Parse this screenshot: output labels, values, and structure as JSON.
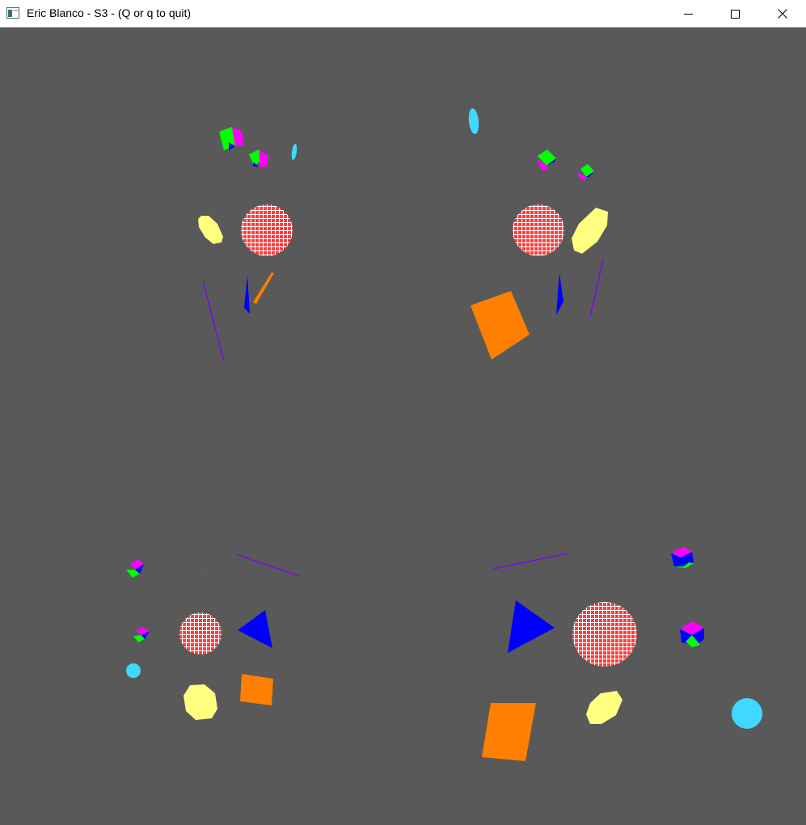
{
  "window": {
    "title": "Eric Blanco - S3 - (Q or q to quit)",
    "controls": [
      "minimize",
      "maximize",
      "close"
    ],
    "icons": {
      "app": "window-app-icon",
      "minimize": "minimize-icon",
      "maximize": "maximize-icon",
      "close": "close-icon"
    }
  },
  "scene": {
    "background_color": "#595959",
    "viewports": [
      "top-left",
      "top-right",
      "bottom-left",
      "bottom-right"
    ],
    "colors": {
      "sphere": "#ff3b3b",
      "sphere_grid": "#ffffff",
      "ellipse": "#ffff80",
      "quad": "#ff7f00",
      "triangle": "#0000ff",
      "line": "#7f00ff",
      "cube_faces": [
        "#00ff00",
        "#ff00ff",
        "#0000ff"
      ],
      "disk": "#40d8ff"
    }
  }
}
